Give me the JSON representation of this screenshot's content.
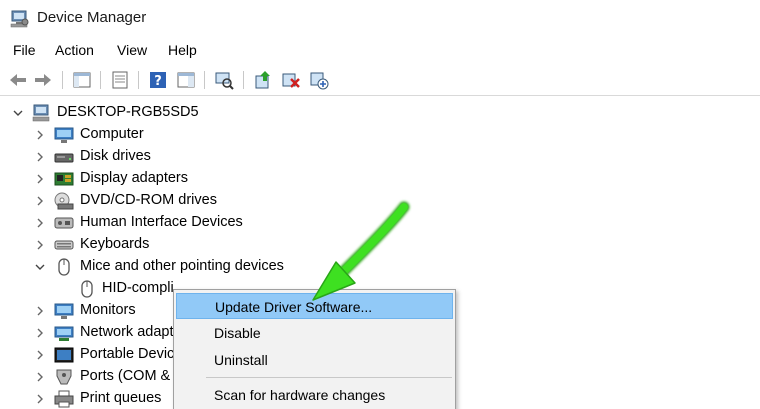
{
  "window": {
    "title": "Device Manager"
  },
  "menu": [
    "File",
    "Action",
    "View",
    "Help"
  ],
  "toolbar": {
    "buttons": [
      "back-icon",
      "forward-icon",
      "show-hide-console-tree-icon",
      "properties-icon",
      "help-icon",
      "action-pane-icon",
      "scan-hardware-icon",
      "update-driver-icon",
      "uninstall-device-icon",
      "add-legacy-hardware-icon"
    ]
  },
  "tree": {
    "root": "DESKTOP-RGB5SD5",
    "items": [
      {
        "label": "Computer",
        "expanded": false
      },
      {
        "label": "Disk drives",
        "expanded": false
      },
      {
        "label": "Display adapters",
        "expanded": false
      },
      {
        "label": "DVD/CD-ROM drives",
        "expanded": false
      },
      {
        "label": "Human Interface Devices",
        "expanded": false
      },
      {
        "label": "Keyboards",
        "expanded": false
      },
      {
        "label": "Mice and other pointing devices",
        "expanded": true
      },
      {
        "label": "HID-compli",
        "child": true,
        "selected": true
      },
      {
        "label": "Monitors",
        "expanded": false
      },
      {
        "label": "Network adapt",
        "expanded": false
      },
      {
        "label": "Portable Devic",
        "expanded": false
      },
      {
        "label": "Ports (COM &",
        "expanded": false
      },
      {
        "label": "Print queues",
        "expanded": false
      }
    ]
  },
  "context_menu": {
    "items": [
      "Update Driver Software...",
      "Disable",
      "Uninstall",
      "Scan for hardware changes"
    ],
    "highlighted": "Update Driver Software..."
  },
  "colors": {
    "highlight": "#91c9f7",
    "arrow": "#3ee021",
    "menu_bg": "#f2f2f2"
  }
}
